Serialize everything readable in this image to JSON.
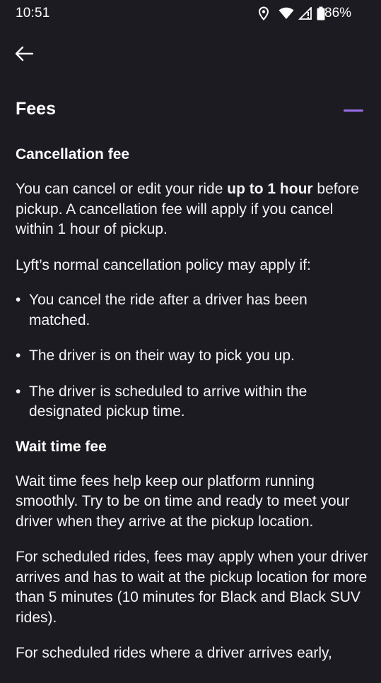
{
  "status_bar": {
    "time": "10:51",
    "battery": "86%",
    "icons": [
      "location-icon",
      "wifi-icon",
      "signal-icon",
      "battery-icon"
    ]
  },
  "nav": {
    "back_icon": "arrow-left-icon"
  },
  "section": {
    "title": "Fees",
    "toggle_icon": "minus-icon",
    "accent_color": "#9b6fe8"
  },
  "cancellation": {
    "heading": "Cancellation fee",
    "p1_before": "You can cancel or edit your ride ",
    "p1_bold": "up to 1 hour",
    "p1_after": " before pickup.  A cancellation fee will apply if you cancel within 1 hour of pickup.",
    "p2": "Lyft’s normal cancellation policy may apply if:",
    "bullets": [
      "You cancel the ride after a driver has been matched.",
      "The driver is on their way to pick you up.",
      "The driver is scheduled to arrive within the designated pickup time."
    ]
  },
  "wait_time": {
    "heading": "Wait time fee",
    "p1": "Wait time fees help keep our platform running smoothly. Try to be on time and ready to meet your driver when they arrive at the pickup location.",
    "p2": "For scheduled rides, fees may apply when your driver arrives and has to wait at the pickup location for more than 5 minutes (10 minutes for Black and Black SUV rides).",
    "p3": "For scheduled rides where a driver arrives early,"
  }
}
